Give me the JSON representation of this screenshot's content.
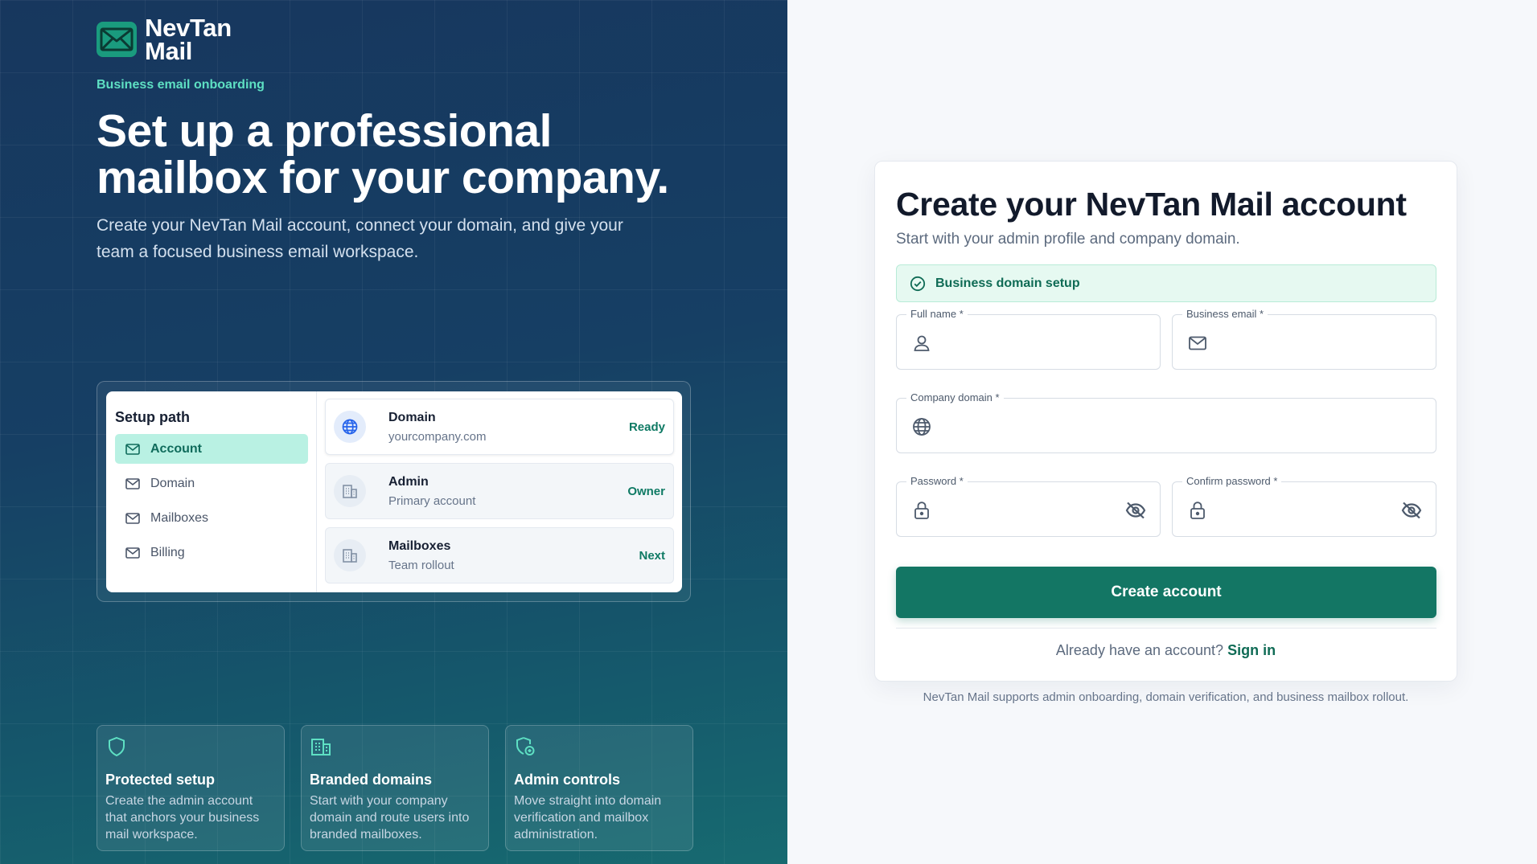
{
  "brand": {
    "name_line1": "NevTan",
    "name_line2": "Mail"
  },
  "hero": {
    "eyebrow": "Business email onboarding",
    "title": "Set up a professional mailbox for your company.",
    "subtitle": "Create your NevTan Mail account, connect your domain, and give your team a focused business email workspace."
  },
  "setup_path": {
    "heading": "Setup path",
    "items": [
      {
        "label": "Account",
        "active": true
      },
      {
        "label": "Domain",
        "active": false
      },
      {
        "label": "Mailboxes",
        "active": false
      },
      {
        "label": "Billing",
        "active": false
      }
    ],
    "steps": [
      {
        "name": "Domain",
        "desc": "yourcompany.com",
        "status": "Ready",
        "icon": "globe-icon"
      },
      {
        "name": "Admin",
        "desc": "Primary account",
        "status": "Owner",
        "icon": "building-icon"
      },
      {
        "name": "Mailboxes",
        "desc": "Team rollout",
        "status": "Next",
        "icon": "building-icon"
      }
    ]
  },
  "features": [
    {
      "title": "Protected setup",
      "desc": "Create the admin account that anchors your business mail workspace.",
      "icon": "shield-icon"
    },
    {
      "title": "Branded domains",
      "desc": "Start with your company domain and route users into branded mailboxes.",
      "icon": "building-grid-icon"
    },
    {
      "title": "Admin controls",
      "desc": "Move straight into domain verification and mailbox administration.",
      "icon": "shield-settings-icon"
    }
  ],
  "form": {
    "title": "Create your NevTan Mail account",
    "subtitle": "Start with your admin profile and company domain.",
    "banner": "Business domain setup",
    "fields": {
      "full_name": {
        "label": "Full name *",
        "value": ""
      },
      "business_email": {
        "label": "Business email *",
        "value": ""
      },
      "company_domain": {
        "label": "Company domain *",
        "value": ""
      },
      "password": {
        "label": "Password *",
        "value": ""
      },
      "confirm_password": {
        "label": "Confirm password *",
        "value": ""
      }
    },
    "submit_label": "Create account",
    "signin_prompt": "Already have an account?",
    "signin_link": "Sign in",
    "footnote": "NevTan Mail supports admin onboarding, domain verification, and business mailbox rollout."
  },
  "colors": {
    "accent": "#137664",
    "hero_bg": "#163f64",
    "highlight": "#5ee0c3"
  }
}
